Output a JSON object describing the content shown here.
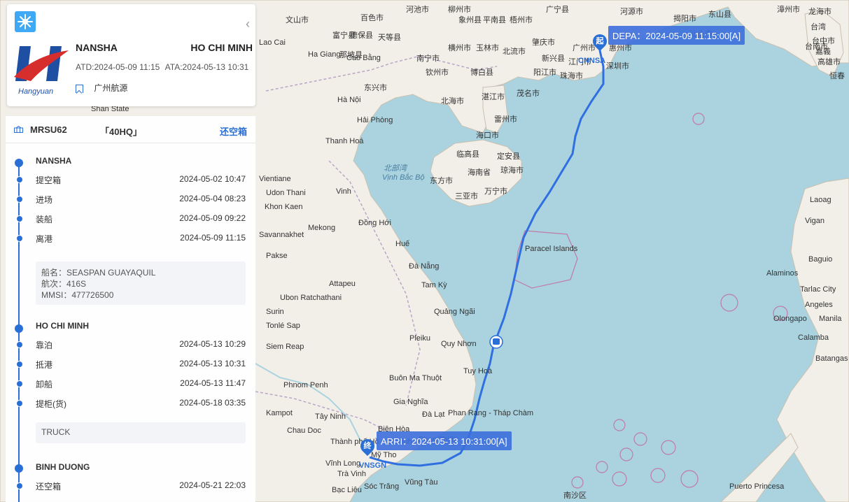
{
  "shipment": {
    "pol": "NANSHA",
    "pod": "HO CHI MINH",
    "atd": "ATD:2024-05-09 11:15",
    "ata": "ATA:2024-05-13 10:31",
    "company": "广州航源",
    "logo_text": "Hangyuan"
  },
  "container": {
    "number": "MRSU62",
    "type": "「40HQ」",
    "status": "还空箱"
  },
  "timeline": {
    "origin": {
      "port": "NANSHA",
      "events": [
        {
          "label": "提空箱",
          "time": "2024-05-02 10:47"
        },
        {
          "label": "进场",
          "time": "2024-05-04 08:23"
        },
        {
          "label": "装船",
          "time": "2024-05-09 09:22"
        },
        {
          "label": "离港",
          "time": "2024-05-09 11:15"
        }
      ],
      "vessel": {
        "name": "船名：SEASPAN GUAYAQUIL",
        "voyage": "航次：416S",
        "mmsi": "MMSI：477726500"
      }
    },
    "destination": {
      "port": "HO CHI MINH",
      "events": [
        {
          "label": "靠泊",
          "time": "2024-05-13 10:29"
        },
        {
          "label": "抵港",
          "time": "2024-05-13 10:31"
        },
        {
          "label": "卸船",
          "time": "2024-05-13 11:47"
        },
        {
          "label": "提柜(货)",
          "time": "2024-05-18 03:35"
        }
      ],
      "transport": "TRUCK"
    },
    "final": {
      "port": "BINH DUONG",
      "events": [
        {
          "label": "还空箱",
          "time": "2024-05-21 22:03"
        }
      ]
    }
  },
  "map": {
    "depart_tag": "DEPA：2024-05-09 11:15:00[A]",
    "arrive_tag": "ARRI：2024-05-13 10:31:00[A]",
    "depart_pin": "起",
    "arrive_pin": "终",
    "depart_code": "CNNSA",
    "arrive_code": "VNSGN",
    "labels": [
      "文山市",
      "富宁县",
      "百色市",
      "那坡县",
      "德保县",
      "天等县",
      "河池市",
      "柳州市",
      "象州县",
      "平南县",
      "梧州市",
      "广宁县",
      "广州市",
      "惠州市",
      "河源市",
      "揭阳市",
      "汕头市",
      "东山县",
      "龙海市",
      "漳州市",
      "Lao Cai",
      "Ha Giang",
      "Cao Bằng",
      "东兴市",
      "钦州市",
      "南宁市",
      "横州市",
      "玉林市",
      "北流市",
      "博白县",
      "湛江市",
      "茂名市",
      "阳江市",
      "新兴县",
      "肇庆市",
      "江门市",
      "深圳市",
      "珠海市",
      "Hà Nội",
      "Hải Phòng",
      "Thanh Hoá",
      "Vinh",
      "Đồng Hới",
      "Huế",
      "Đà Nẵng",
      "Tam Kỳ",
      "Quảng Ngãi",
      "Quy Nhơn",
      "Tuy Hoà",
      "Pleiku",
      "Buôn Ma Thuột",
      "Gia Nghĩa",
      "Đà Lạt",
      "Phan Rang - Tháp Chàm",
      "Phan Thiết",
      "Biên Hòa",
      "Thành phố Hồ Chí Minh",
      "Vĩnh Long",
      "Trà Vinh",
      "Bạc Liêu",
      "Mỹ Tho",
      "Vũng Tàu",
      "Sóc Trăng",
      "北海市",
      "雷州市",
      "海口市",
      "临高县",
      "定安县",
      "琼海市",
      "东方市",
      "万宁市",
      "三亚市",
      "海南省",
      "北部湾",
      "Vịnh Bắc Bộ",
      "Mekong",
      "Tonlé Sap",
      "Savannakhet",
      "Pakse",
      "Attapeu",
      "Vientiane",
      "Udon Thani",
      "Khon Kaen",
      "Ubon Ratchathani",
      "Surin",
      "Siem Reap",
      "Phnom Penh",
      "Kampot",
      "Tây Ninh",
      "Chau Doc",
      "Laoag",
      "Vigan",
      "Baguio",
      "Tarlac City",
      "Angeles",
      "Manila",
      "Olongapo",
      "Calamba",
      "Batangas",
      "Alaminos",
      "Puerto Princesa",
      "台湾",
      "台中市",
      "嘉義",
      "高雄市",
      "台南市",
      "恒春",
      "Paracel Islands",
      "Shan State",
      "南沙区"
    ]
  }
}
